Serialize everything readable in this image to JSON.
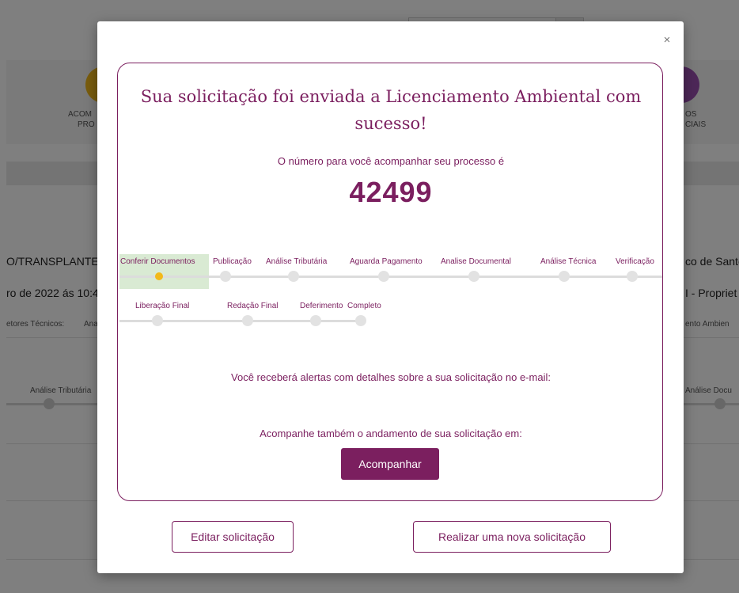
{
  "background": {
    "left_title": "O/TRANSPLANTE",
    "left_date": "ro de 2022 ás 10:4",
    "left_setores": "etores Técnicos:",
    "left_setores_val": "Ana",
    "left_step": "Análise Tributária",
    "left_icon_label1": "ACOM",
    "left_icon_label2": "PRO",
    "right_icon_label1": "OS",
    "right_icon_label2": "CIAIS",
    "right_title": "co de Santo",
    "right_subtitle": "I - Propriet",
    "right_small": "ento Ambien",
    "right_step": "Análise Docu",
    "accent_left": "#f2b91a",
    "accent_right": "#9b4fb0"
  },
  "modal": {
    "close_label": "×",
    "title": "Sua solicitação foi enviada a Licenciamento Ambiental com sucesso!",
    "process_label": "O número para você acompanhar seu processo é",
    "process_number": "42499",
    "steps": [
      "Conferir Documentos",
      "Publicação",
      "Análise Tributária",
      "Aguarda Pagamento",
      "Analise Documental",
      "Análise Técnica",
      "Verificação",
      "Liberação Final",
      "Redação Final",
      "Deferimento",
      "Completo"
    ],
    "active_step": "Conferir Documentos",
    "email_text": "Você receberá alertas com detalhes sobre a sua solicitação no e-mail:",
    "track_text": "Acompanhe também o andamento de sua solicitação em:",
    "track_button": "Acompanhar",
    "edit_button": "Editar solicitação",
    "new_button": "Realizar uma nova solicitação"
  },
  "colors": {
    "brand": "#7b1f5f",
    "active_dot": "#f2b91a",
    "active_highlight": "#d9ead3"
  }
}
